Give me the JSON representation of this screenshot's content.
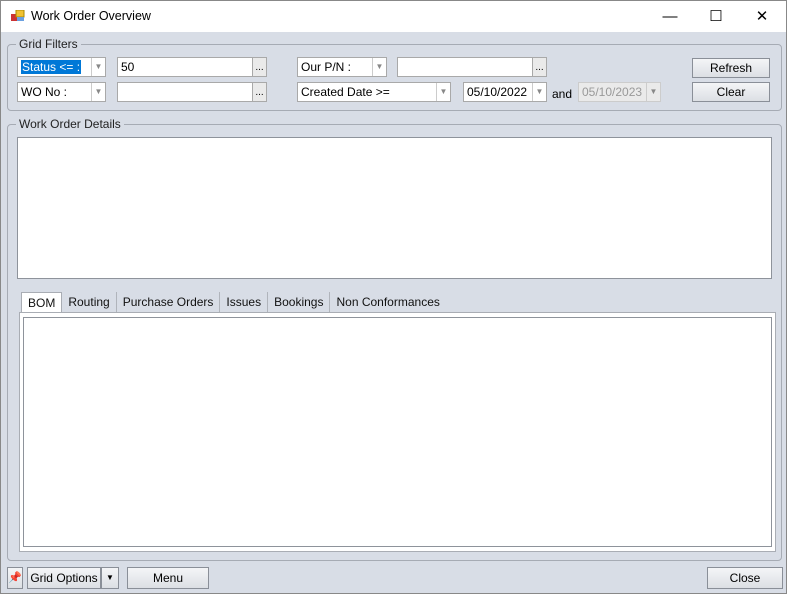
{
  "window": {
    "title": "Work Order Overview",
    "minimize": "—",
    "maximize": "☐",
    "close": "✕"
  },
  "filters": {
    "label": "Grid Filters",
    "field1": "Status <= :",
    "value1": "50",
    "field2": "WO No :",
    "value2": "",
    "field3": "Our P/N :",
    "value3": "",
    "field4": "Created Date >=",
    "date_from": "05/10/2022",
    "and_label": "and",
    "date_to": "05/10/2023",
    "ellipsis": "...",
    "refresh": "Refresh",
    "clear": "Clear"
  },
  "details": {
    "label": "Work Order Details"
  },
  "tabs": [
    {
      "label": "BOM"
    },
    {
      "label": "Routing"
    },
    {
      "label": "Purchase Orders"
    },
    {
      "label": "Issues"
    },
    {
      "label": "Bookings"
    },
    {
      "label": "Non Conformances"
    }
  ],
  "footer": {
    "grid_options": "Grid Options",
    "menu": "Menu",
    "close": "Close"
  }
}
